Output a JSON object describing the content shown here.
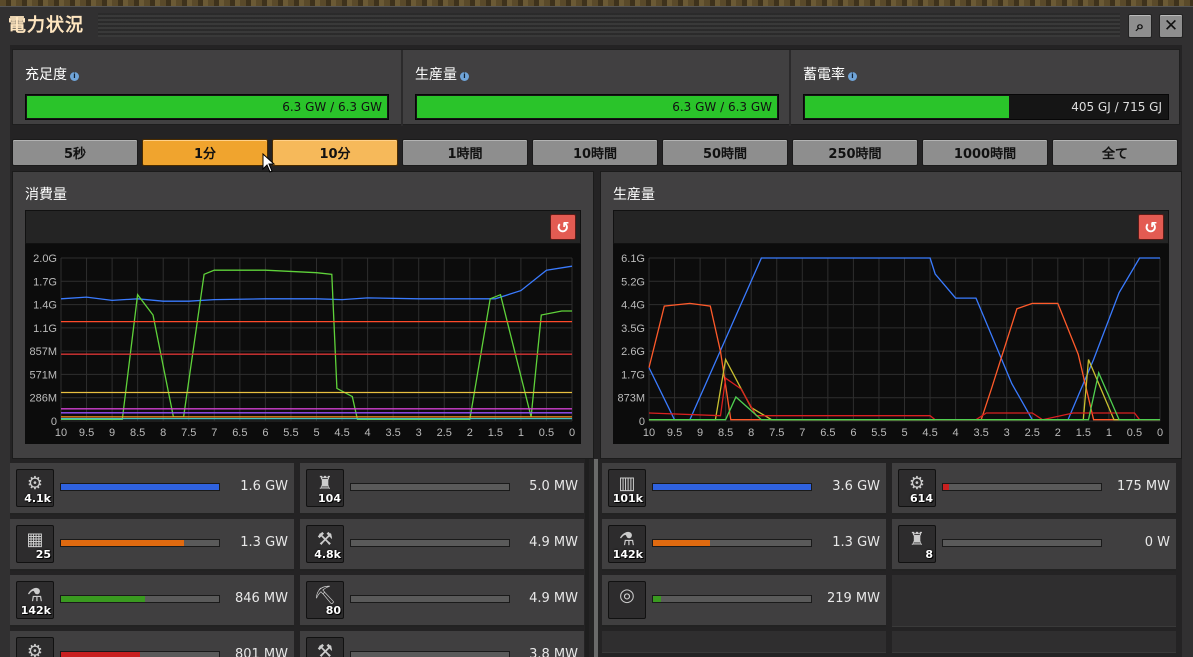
{
  "window": {
    "title": "電力状況"
  },
  "stats": [
    {
      "label": "充足度",
      "value": "6.3 GW / 6.3 GW",
      "fill": 1.0
    },
    {
      "label": "生産量",
      "value": "6.3 GW / 6.3 GW",
      "fill": 1.0
    },
    {
      "label": "蓄電率",
      "value": "405 GJ / 715 GJ",
      "fill": 0.566
    }
  ],
  "time_buttons": [
    "5秒",
    "1分",
    "10分",
    "1時間",
    "10時間",
    "50時間",
    "250時間",
    "1000時間",
    "全て"
  ],
  "time_selected": "1分",
  "time_hovered": "10分",
  "consumption": {
    "title": "消費量",
    "chart_data": {
      "type": "line",
      "x_ticks": [
        "10",
        "9.5",
        "9",
        "8.5",
        "8",
        "7.5",
        "7",
        "6.5",
        "6",
        "5.5",
        "5",
        "4.5",
        "4",
        "3.5",
        "3",
        "2.5",
        "2",
        "1.5",
        "1",
        "0.5",
        "0"
      ],
      "y_ticks": [
        "2.0G",
        "1.7G",
        "1.4G",
        "1.1G",
        "857M",
        "571M",
        "286M",
        "0"
      ],
      "xlim": [
        10,
        0
      ],
      "ylim": [
        0,
        2.0
      ],
      "series": [
        {
          "color": "#3a7bff",
          "points": [
            [
              10,
              1.5
            ],
            [
              9.5,
              1.52
            ],
            [
              9,
              1.48
            ],
            [
              8.5,
              1.5
            ],
            [
              8,
              1.47
            ],
            [
              7.5,
              1.47
            ],
            [
              7,
              1.49
            ],
            [
              6,
              1.5
            ],
            [
              5,
              1.5
            ],
            [
              4.5,
              1.49
            ],
            [
              4,
              1.51
            ],
            [
              3,
              1.5
            ],
            [
              2,
              1.5
            ],
            [
              1.5,
              1.5
            ],
            [
              1,
              1.6
            ],
            [
              0.5,
              1.85
            ],
            [
              0,
              1.9
            ]
          ]
        },
        {
          "color": "#5fd23a",
          "points": [
            [
              10,
              0.02
            ],
            [
              8.8,
              0.02
            ],
            [
              8.5,
              1.55
            ],
            [
              8.2,
              1.3
            ],
            [
              7.8,
              0.05
            ],
            [
              7.6,
              0.05
            ],
            [
              7.2,
              1.8
            ],
            [
              7,
              1.85
            ],
            [
              6,
              1.85
            ],
            [
              5,
              1.82
            ],
            [
              4.7,
              1.8
            ],
            [
              4.6,
              0.4
            ],
            [
              4.3,
              0.3
            ],
            [
              4.2,
              0.02
            ],
            [
              2,
              0.02
            ],
            [
              1.6,
              1.5
            ],
            [
              1.4,
              1.55
            ],
            [
              0.8,
              0.05
            ],
            [
              0.6,
              1.3
            ],
            [
              0.2,
              1.35
            ],
            [
              0,
              1.35
            ]
          ]
        },
        {
          "color": "#ff4a2a",
          "points": [
            [
              10,
              1.22
            ],
            [
              0,
              1.22
            ]
          ]
        },
        {
          "color": "#d83434",
          "points": [
            [
              10,
              0.82
            ],
            [
              0,
              0.82
            ]
          ]
        },
        {
          "color": "#e8c040",
          "points": [
            [
              10,
              0.35
            ],
            [
              0,
              0.35
            ]
          ]
        },
        {
          "color": "#d040d0",
          "points": [
            [
              10,
              0.15
            ],
            [
              0,
              0.15
            ]
          ]
        },
        {
          "color": "#9a50ff",
          "points": [
            [
              10,
              0.1
            ],
            [
              0,
              0.1
            ]
          ]
        },
        {
          "color": "#ff9020",
          "points": [
            [
              10,
              0.05
            ],
            [
              0,
              0.05
            ]
          ]
        },
        {
          "color": "#40c0c0",
          "points": [
            [
              10,
              0.03
            ],
            [
              0,
              0.03
            ]
          ]
        }
      ]
    }
  },
  "production": {
    "title": "生産量",
    "chart_data": {
      "type": "line",
      "x_ticks": [
        "10",
        "9.5",
        "9",
        "8.5",
        "8",
        "7.5",
        "7",
        "6.5",
        "6",
        "5.5",
        "5",
        "4.5",
        "4",
        "3.5",
        "3",
        "2.5",
        "2",
        "1.5",
        "1",
        "0.5",
        "0"
      ],
      "y_ticks": [
        "6.1G",
        "5.2G",
        "4.4G",
        "3.5G",
        "2.6G",
        "1.7G",
        "873M",
        "0"
      ],
      "xlim": [
        10,
        0
      ],
      "ylim": [
        0,
        6.1
      ],
      "series": [
        {
          "color": "#3a7bff",
          "points": [
            [
              10,
              2.0
            ],
            [
              9.5,
              0.05
            ],
            [
              9.3,
              0.05
            ],
            [
              9.2,
              0.05
            ],
            [
              7.8,
              6.1
            ],
            [
              4.5,
              6.1
            ],
            [
              4.4,
              5.5
            ],
            [
              4,
              4.6
            ],
            [
              3.6,
              4.6
            ],
            [
              2.9,
              1.4
            ],
            [
              2.5,
              0.05
            ],
            [
              1.8,
              0.05
            ],
            [
              1.3,
              2.3
            ],
            [
              0.8,
              4.8
            ],
            [
              0.4,
              6.1
            ],
            [
              0,
              6.1
            ]
          ]
        },
        {
          "color": "#ff5a2a",
          "points": [
            [
              10,
              2.0
            ],
            [
              9.7,
              4.3
            ],
            [
              9.2,
              4.4
            ],
            [
              8.8,
              4.3
            ],
            [
              8.6,
              2.6
            ],
            [
              8.4,
              0.05
            ],
            [
              3.5,
              0.05
            ],
            [
              3.3,
              1.2
            ],
            [
              2.8,
              4.2
            ],
            [
              2.5,
              4.4
            ],
            [
              2.0,
              4.4
            ],
            [
              1.6,
              2.5
            ],
            [
              1.3,
              0.05
            ],
            [
              0,
              0.05
            ]
          ]
        },
        {
          "color": "#c8c030",
          "points": [
            [
              10,
              0.05
            ],
            [
              8.7,
              0.05
            ],
            [
              8.5,
              2.3
            ],
            [
              8.0,
              0.5
            ],
            [
              7.6,
              0.05
            ],
            [
              1.5,
              0.05
            ],
            [
              1.4,
              2.3
            ],
            [
              0.9,
              0.05
            ],
            [
              0,
              0.05
            ]
          ]
        },
        {
          "color": "#d82020",
          "points": [
            [
              10,
              0.3
            ],
            [
              8.6,
              0.2
            ],
            [
              8.5,
              1.6
            ],
            [
              8.2,
              1.2
            ],
            [
              7.9,
              0.2
            ],
            [
              4.5,
              0.2
            ],
            [
              4.4,
              0.05
            ],
            [
              3.6,
              0.05
            ],
            [
              3.4,
              0.3
            ],
            [
              2.5,
              0.3
            ],
            [
              2.3,
              0.05
            ],
            [
              1.7,
              0.3
            ],
            [
              1.4,
              0.3
            ],
            [
              0.5,
              0.3
            ],
            [
              0.4,
              0.05
            ],
            [
              0,
              0.05
            ]
          ]
        },
        {
          "color": "#50d050",
          "points": [
            [
              10,
              0.05
            ],
            [
              8.5,
              0.05
            ],
            [
              8.3,
              0.9
            ],
            [
              7.8,
              0.05
            ],
            [
              1.4,
              0.05
            ],
            [
              1.2,
              1.8
            ],
            [
              0.8,
              0.05
            ],
            [
              0,
              0.05
            ]
          ]
        }
      ]
    }
  },
  "consumption_list": [
    {
      "icon": "assembler-icon",
      "glyph": "⚙",
      "count": "4.1k",
      "value": "1.6 GW",
      "fill": 1.0,
      "color": "#2f62e0"
    },
    {
      "icon": "pump-icon",
      "glyph": "♜",
      "count": "104",
      "value": "5.0 MW",
      "fill": 0.0,
      "color": "#888888"
    },
    {
      "icon": "furnace-icon",
      "glyph": "▦",
      "count": "25",
      "value": "1.3 GW",
      "fill": 0.78,
      "color": "#e06a10"
    },
    {
      "icon": "inserter-icon",
      "glyph": "⚒",
      "count": "4.8k",
      "value": "4.9 MW",
      "fill": 0.0,
      "color": "#888888"
    },
    {
      "icon": "lab-icon",
      "glyph": "⚗",
      "count": "142k",
      "value": "846 MW",
      "fill": 0.53,
      "color": "#3a9a20"
    },
    {
      "icon": "pumpjack-icon",
      "glyph": "⛏",
      "count": "80",
      "value": "4.9 MW",
      "fill": 0.0,
      "color": "#888888"
    },
    {
      "icon": "machine-icon",
      "glyph": "⚙",
      "count": "",
      "value": "801 MW",
      "fill": 0.5,
      "color": "#c82020"
    },
    {
      "icon": "belt-icon",
      "glyph": "⚒",
      "count": "",
      "value": "3.8 MW",
      "fill": 0.0,
      "color": "#888888"
    }
  ],
  "production_list": [
    {
      "icon": "solar-panel-icon",
      "glyph": "▥",
      "count": "101k",
      "value": "3.6 GW",
      "fill": 1.0,
      "color": "#2f62e0"
    },
    {
      "icon": "steam-engine-icon",
      "glyph": "⚙",
      "count": "614",
      "value": "175 MW",
      "fill": 0.04,
      "color": "#c82020"
    },
    {
      "icon": "accumulator-icon",
      "glyph": "⚗",
      "count": "142k",
      "value": "1.3 GW",
      "fill": 0.36,
      "color": "#e06a10"
    },
    {
      "icon": "reactor-icon",
      "glyph": "♜",
      "count": "8",
      "value": "0 W",
      "fill": 0.0,
      "color": "#888888"
    },
    {
      "icon": "turbine-icon",
      "glyph": "◎",
      "count": "",
      "value": "219 MW",
      "fill": 0.05,
      "color": "#3a9a20"
    }
  ]
}
